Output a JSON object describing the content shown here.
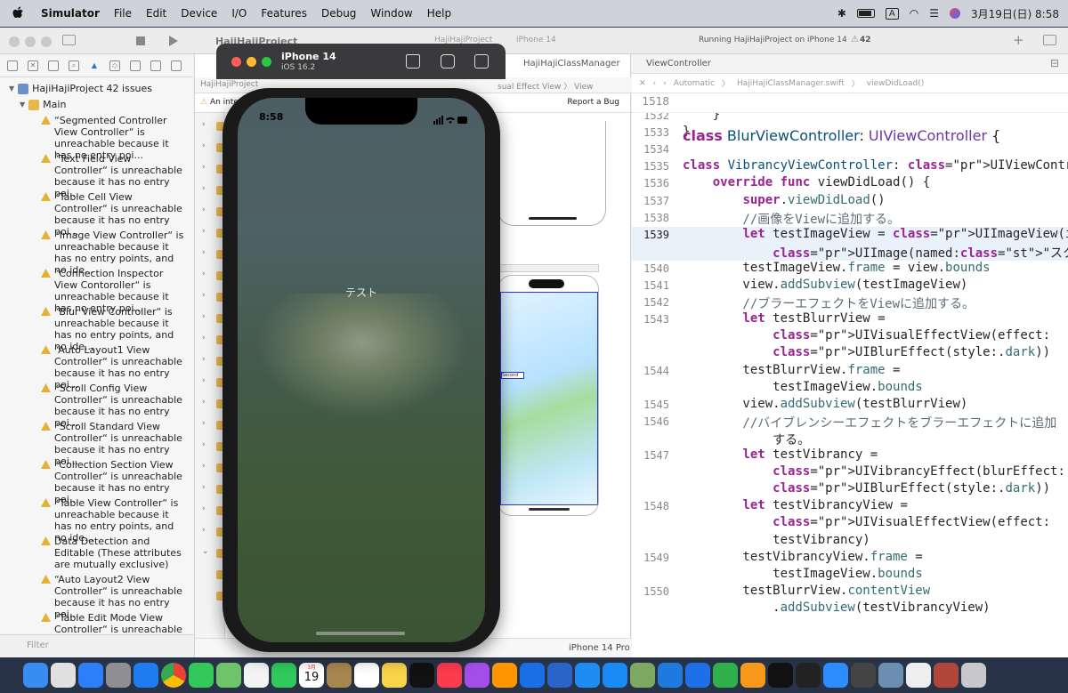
{
  "menubar": {
    "app": "Simulator",
    "items": [
      "File",
      "Edit",
      "Device",
      "I/O",
      "Features",
      "Debug",
      "Window",
      "Help"
    ],
    "input_mode": "A",
    "datetime": "3月19日(日) 8:58"
  },
  "xcode": {
    "project_title": "HajiHajiProject",
    "scheme": "HajiHajiProject",
    "destination": "iPhone 14",
    "status": "Running HajiHajiProject on iPhone 14",
    "warning_count": "42",
    "navigator": {
      "project": "HajiHajiProject 42 issues",
      "group": "Main",
      "issues": [
        "“Segmented Controller View Controller“ is unreachable because it has no entry poi...",
        "“Text Field View Controller“ is unreachable because it has no entry poi...",
        "“Table Cell View Controller“ is unreachable because it has no entry poi...",
        "“Image View Controller“ is unreachable because it has no entry points, and no ide...",
        "“Connection Inspector View Contoroller“ is unreachable because it has no entry poi...",
        "“Blur View Controller“ is unreachable because it has no entry points, and no ide...",
        "“Auto Layout1 View Controller“ is unreachable because it has no entry poi...",
        "“Scroll Config View Controller“ is unreachable because it has no entry poi...",
        "“Scroll Standard View Controller“ is unreachable because it has no entry poi...",
        "“Collection Section View Controller“ is unreachable because it has no entry poi...",
        "“Table View Controller“ is unreachable because it has no entry points, and no ide...",
        "Data Detection and Editable (These attributes are mutually exclusive)",
        "“Auto Layout2 View Controller“ is unreachable because it has no entry poi...",
        "“Table Edit Mode View Controller“ is unreachable"
      ],
      "filter_placeholder": "Filter"
    },
    "canvas": {
      "jump_crumb": "HajiHajiProject",
      "jump_crumb_end": "sual Effect View 〉 View",
      "warning_text": "An inte",
      "report_bug": "Report a Bug",
      "storyboard_label": "Second",
      "device_bottom": "iPhone 14 Pro"
    },
    "editor": {
      "tabs": [
        "HajiHajiClassManager",
        "ViewController"
      ],
      "jump": [
        "Automatic",
        "HajiHajiClassManager.swift",
        "viewDidLoad()"
      ],
      "sticky_line_number": "1518",
      "sticky_code": "class BlurViewController: UIViewController {",
      "lines": [
        {
          "n": "1532",
          "code": "    }"
        },
        {
          "n": "1533",
          "code": "}"
        },
        {
          "n": "1534",
          "code": ""
        },
        {
          "n": "1535",
          "code": "class VibrancyViewController: UIViewController {"
        },
        {
          "n": "1536",
          "code": "    override func viewDidLoad() {"
        },
        {
          "n": "1537",
          "code": "        super.viewDidLoad()"
        },
        {
          "n": "1538",
          "code": "        //画像をViewに追加する。"
        },
        {
          "n": "1539",
          "code": "        let testImageView = UIImageView(image:"
        },
        {
          "n": "",
          "code": "            UIImage(named:\"スクロールキーボード\"))"
        },
        {
          "n": "1540",
          "code": "        testImageView.frame = view.bounds"
        },
        {
          "n": "1541",
          "code": "        view.addSubview(testImageView)"
        },
        {
          "n": "1542",
          "code": "        //ブラーエフェクトをViewに追加する。"
        },
        {
          "n": "1543",
          "code": "        let testBlurrView ="
        },
        {
          "n": "",
          "code": "            UIVisualEffectView(effect:"
        },
        {
          "n": "",
          "code": "            UIBlurEffect(style:.dark))"
        },
        {
          "n": "1544",
          "code": "        testBlurrView.frame ="
        },
        {
          "n": "",
          "code": "            testImageView.bounds"
        },
        {
          "n": "1545",
          "code": "        view.addSubview(testBlurrView)"
        },
        {
          "n": "1546",
          "code": "        //バイブレンシーエフェクトをブラーエフェクトに追加"
        },
        {
          "n": "",
          "code": "            する。"
        },
        {
          "n": "1547",
          "code": "        let testVibrancy ="
        },
        {
          "n": "",
          "code": "            UIVibrancyEffect(blurEffect:"
        },
        {
          "n": "",
          "code": "            UIBlurEffect(style:.dark))"
        },
        {
          "n": "1548",
          "code": "        let testVibrancyView ="
        },
        {
          "n": "",
          "code": "            UIVisualEffectView(effect:"
        },
        {
          "n": "",
          "code": "            testVibrancy)"
        },
        {
          "n": "1549",
          "code": "        testVibrancyView.frame ="
        },
        {
          "n": "",
          "code": "            testImageView.bounds"
        },
        {
          "n": "1550",
          "code": "        testBlurrView.contentView"
        },
        {
          "n": "",
          "code": "            .addSubview(testVibrancyView)"
        }
      ]
    }
  },
  "simulator": {
    "device": "iPhone 14",
    "os": "iOS 16.2",
    "time": "8:58",
    "label": "テスト"
  },
  "dock": {
    "calendar_month": "3月",
    "calendar_day": "19",
    "apps": [
      "finder-icon",
      "launchpad-icon",
      "mail-icon",
      "system-settings-icon",
      "safari-icon",
      "chrome-icon",
      "messages-icon",
      "maps-icon",
      "photos-icon",
      "facetime-icon",
      "calendar-icon",
      "notes-brown-icon",
      "reminders-icon",
      "notes-icon",
      "apple-tv-icon",
      "music-icon",
      "podcasts-icon",
      "books-icon",
      "xcode-icon",
      "simulator-icon",
      "files-icon",
      "app-store-icon",
      "coteditor-icon",
      "vscode-icon",
      "keynote-icon",
      "numbers-icon",
      "pages-icon",
      "chatgpt-icon",
      "terminal-icon",
      "zoom-icon",
      "calculator-icon",
      "preview-icon",
      "textedit-icon",
      "dictionary-icon",
      "trash-icon"
    ]
  }
}
